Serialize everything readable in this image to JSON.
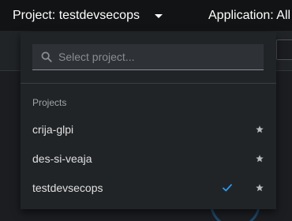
{
  "masthead": {
    "project_label": "Project: testdevsecops",
    "application_label": "Application: All"
  },
  "project_menu": {
    "search_placeholder": "Select project...",
    "group_title": "Projects",
    "items": [
      {
        "label": "crija-glpi",
        "selected": false,
        "favorite_icon": "star-icon"
      },
      {
        "label": "des-si-veaja",
        "selected": false,
        "favorite_icon": "star-icon"
      },
      {
        "label": "testdevsecops",
        "selected": true,
        "favorite_icon": "star-icon",
        "selected_icon": "check-icon"
      }
    ]
  },
  "colors": {
    "accent": "#2b9af3",
    "menu_background": "#212427",
    "masthead_background": "#121314"
  }
}
